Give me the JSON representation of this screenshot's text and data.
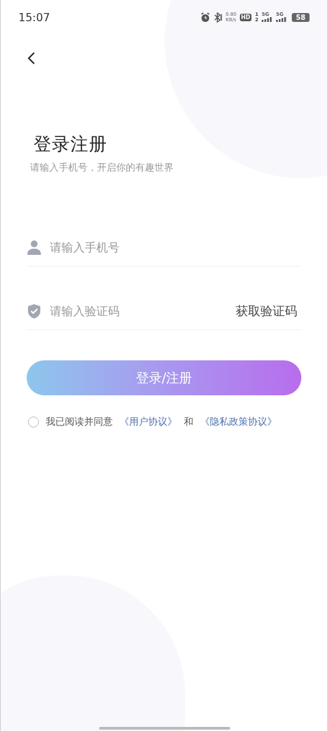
{
  "status_bar": {
    "time": "15:07",
    "speed_value": "0.80",
    "speed_unit": "KB/s",
    "hd_badge": "HD",
    "sim_1": "1",
    "sim_2": "2",
    "network_1": "5G",
    "network_2": "5G",
    "battery": "58"
  },
  "header": {
    "title": "登录注册",
    "subtitle": "请输入手机号，开启你的有趣世界"
  },
  "fields": [
    {
      "kind": "phone",
      "placeholder": "请输入手机号"
    },
    {
      "kind": "code",
      "placeholder": "请输入验证码",
      "action": "获取验证码"
    }
  ],
  "submit": {
    "label": "登录/注册"
  },
  "agreement": {
    "checked": false,
    "parts": [
      {
        "kind": "text",
        "text": "我已阅读并同意"
      },
      {
        "kind": "link",
        "text": "《用户协议》"
      },
      {
        "kind": "text",
        "text": "和"
      },
      {
        "kind": "link",
        "text": "《隐私政策协议》"
      }
    ]
  }
}
